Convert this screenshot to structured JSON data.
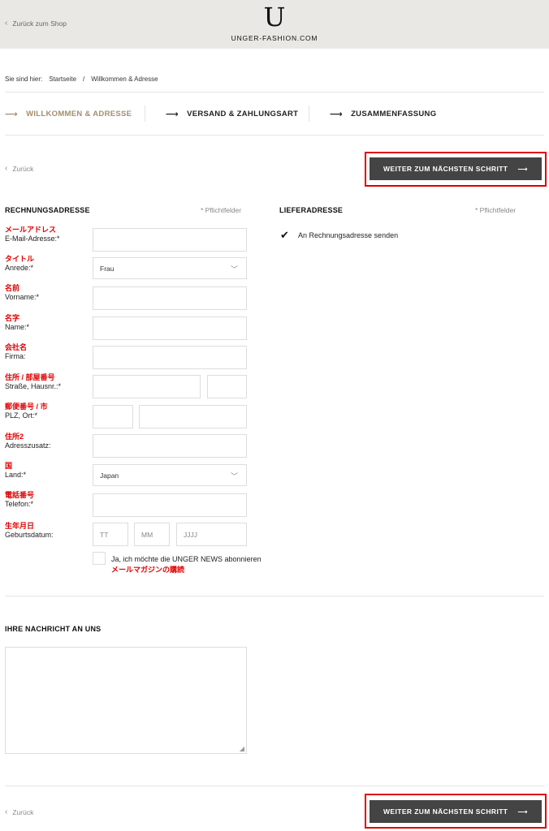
{
  "header": {
    "back_to_shop": "Zurück zum Shop",
    "logo_letter": "U",
    "logo_text": "UNGER-FASHION.COM"
  },
  "breadcrumb": {
    "prefix": "Sie sind hier:",
    "items": [
      "Startseite",
      "/",
      "Willkommen & Adresse"
    ]
  },
  "steps": [
    {
      "label": "WILLKOMMEN & ADRESSE",
      "active": true
    },
    {
      "label": "VERSAND & ZAHLUNGSART",
      "active": false
    },
    {
      "label": "ZUSAMMENFASSUNG",
      "active": false
    }
  ],
  "nav": {
    "back_label": "Zurück",
    "next_label": "WEITER ZUM NÄCHSTEN SCHRITT"
  },
  "billing": {
    "title": "RECHNUNGSADRESSE",
    "required_note": "* Pflichtfelder",
    "fields": {
      "email": {
        "jp": "メールアドレス",
        "de": "E-Mail-Adresse:*",
        "value": ""
      },
      "salutation": {
        "jp": "タイトル",
        "de": "Anrede:*",
        "value": "Frau"
      },
      "firstname": {
        "jp": "名前",
        "de": "Vorname:*",
        "value": ""
      },
      "lastname": {
        "jp": "名字",
        "de": "Name:*",
        "value": ""
      },
      "company": {
        "jp": "会社名",
        "de": "Firma:",
        "value": ""
      },
      "street": {
        "jp": "住所 / 部屋番号",
        "de": "Straße, Hausnr.:*",
        "value": ""
      },
      "zipcity": {
        "jp": "郵便番号 / 市",
        "de": "PLZ, Ort:*",
        "value": ""
      },
      "addition": {
        "jp": "住所2",
        "de": "Adresszusatz:",
        "value": ""
      },
      "country": {
        "jp": "国",
        "de": "Land:*",
        "value": "Japan"
      },
      "phone": {
        "jp": "電話番号",
        "de": "Telefon:*",
        "value": ""
      },
      "birthdate": {
        "jp": "生年月日",
        "de": "Geburtsdatum:",
        "day_placeholder": "TT",
        "month_placeholder": "MM",
        "year_placeholder": "JJJJ"
      }
    },
    "newsletter": {
      "label": "Ja, ich möchte die UNGER NEWS abonnieren",
      "jp": "メールマガジンの購読",
      "checked": false
    }
  },
  "delivery": {
    "title": "LIEFERADRESSE",
    "required_note": "* Pflichtfelder",
    "same_as_billing_label": "An Rechnungsadresse senden",
    "same_as_billing_checked": true
  },
  "message": {
    "title": "IHRE NACHRICHT AN UNS",
    "value": ""
  },
  "colors": {
    "accent": "#a58c6e",
    "button": "#444444",
    "annotation_red": "#e00000",
    "header_bg": "#e9e8e4"
  }
}
